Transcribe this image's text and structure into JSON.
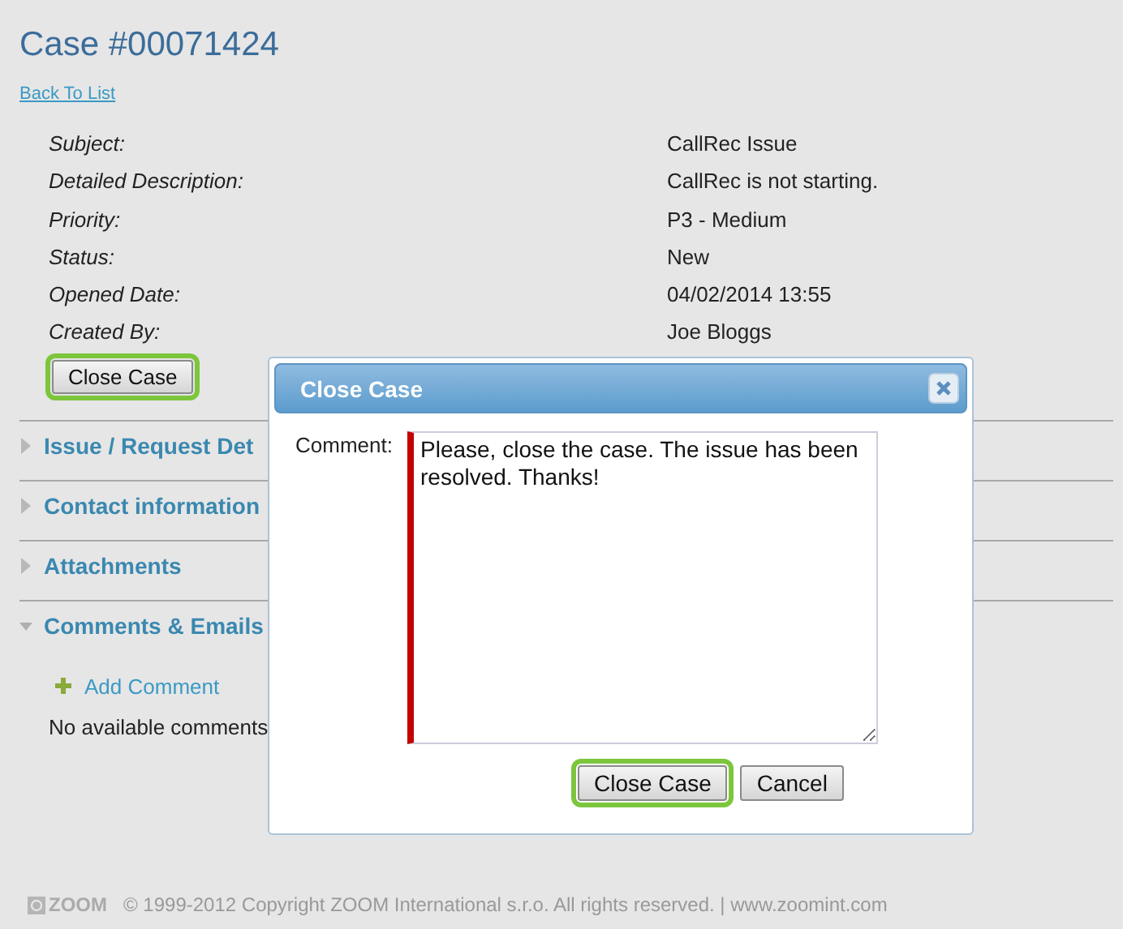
{
  "title": "Case #00071424",
  "back_link": "Back To List",
  "details": [
    {
      "label": "Subject:",
      "value": "CallRec Issue"
    },
    {
      "label": "Detailed Description:",
      "value": "CallRec is not starting."
    },
    {
      "label": "Priority:",
      "value": "P3 - Medium"
    },
    {
      "label": "Status:",
      "value": "New"
    },
    {
      "label": "Opened Date:",
      "value": "04/02/2014 13:55"
    },
    {
      "label": "Created By:",
      "value": "Joe Bloggs"
    }
  ],
  "close_button": {
    "label": "Close Case",
    "highlighted": true
  },
  "sections": [
    {
      "title": "Issue / Request Det",
      "expanded": false
    },
    {
      "title": "Contact information",
      "expanded": false
    },
    {
      "title": "Attachments",
      "expanded": false
    },
    {
      "title": "Comments & Emails",
      "expanded": true,
      "add_link": "Add Comment",
      "empty_text": "No available comments"
    }
  ],
  "dialog": {
    "title": "Close Case",
    "comment_label": "Comment:",
    "comment_value": "Please, close the case. The issue has been resolved. Thanks!",
    "buttons": [
      {
        "label": "Close Case",
        "highlighted": true
      },
      {
        "label": "Cancel",
        "highlighted": false
      }
    ]
  },
  "footer": {
    "logo": "ZOOM",
    "text": "© 1999-2012 Copyright ZOOM International s.r.o. All rights reserved. | www.zoomint.com"
  }
}
